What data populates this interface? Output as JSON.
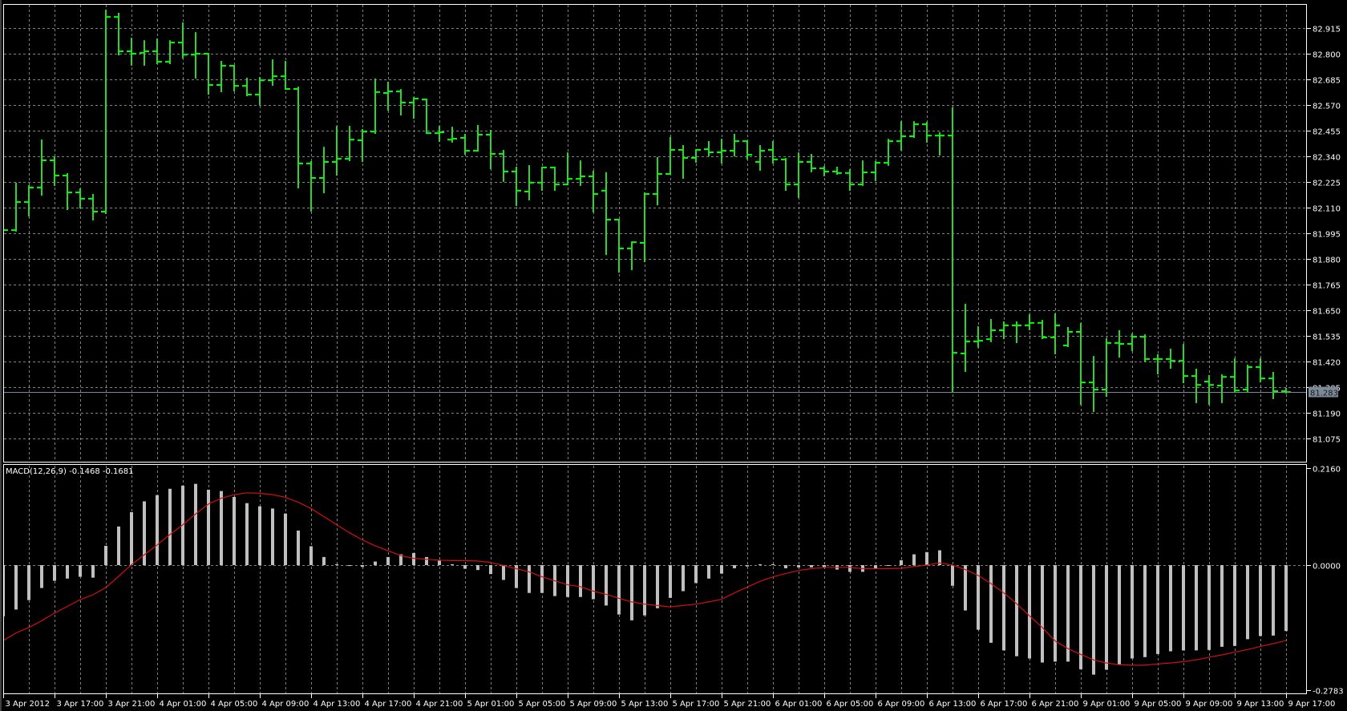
{
  "colors": {
    "background": "#000000",
    "bar_vertical": "#2bd62b",
    "bar_ticks": "#00ff00",
    "grid": "#7f7f7f",
    "border": "#ffffff",
    "histogram": "#c0c0c0",
    "signal": "#d01010",
    "price_line": "#778899",
    "price_label_bg": "#7b8a99",
    "price_label_text": "#1a1a1a"
  },
  "indicator": {
    "title": "MACD(12,26,9) -0.1468 -0.1681"
  },
  "current_price": {
    "label": "81.283",
    "value": 81.283
  },
  "chart_data": [
    {
      "type": "ohlc",
      "title": "",
      "ylim": [
        80.967,
        83.023
      ],
      "grid": true,
      "y_ticks": [
        "82.915",
        "82.800",
        "82.685",
        "82.570",
        "82.455",
        "82.340",
        "82.225",
        "82.110",
        "81.995",
        "81.880",
        "81.765",
        "81.650",
        "81.535",
        "81.420",
        "81.305",
        "81.190",
        "81.075"
      ],
      "x_tick_labels": [
        "3 Apr 2012",
        "3 Apr 17:00",
        "3 Apr 21:00",
        "4 Apr 01:00",
        "4 Apr 05:00",
        "4 Apr 09:00",
        "4 Apr 13:00",
        "4 Apr 17:00",
        "4 Apr 21:00",
        "5 Apr 01:00",
        "5 Apr 05:00",
        "5 Apr 09:00",
        "5 Apr 13:00",
        "5 Apr 17:00",
        "5 Apr 21:00",
        "6 Apr 01:00",
        "6 Apr 05:00",
        "6 Apr 09:00",
        "6 Apr 13:00",
        "6 Apr 17:00",
        "6 Apr 21:00",
        "9 Apr 01:00",
        "9 Apr 05:00",
        "9 Apr 09:00",
        "9 Apr 13:00",
        "9 Apr 17:00"
      ],
      "bars_per_x_label": 4,
      "ohlc": [
        [
          82.0,
          82.012,
          81.995,
          82.009
        ],
        [
          82.009,
          82.218,
          82.006,
          82.135
        ],
        [
          82.135,
          82.207,
          82.074,
          82.2
        ],
        [
          82.2,
          82.412,
          82.167,
          82.322
        ],
        [
          82.322,
          82.336,
          82.211,
          82.254
        ],
        [
          82.254,
          82.261,
          82.103,
          82.178
        ],
        [
          82.178,
          82.193,
          82.11,
          82.15
        ],
        [
          82.15,
          82.168,
          82.056,
          82.092
        ],
        [
          82.092,
          82.994,
          82.085,
          82.965
        ],
        [
          82.965,
          82.98,
          82.796,
          82.811
        ],
        [
          82.811,
          82.868,
          82.75,
          82.8
        ],
        [
          82.804,
          82.857,
          82.75,
          82.811
        ],
        [
          82.811,
          82.865,
          82.757,
          82.764
        ],
        [
          82.764,
          82.857,
          82.757,
          82.85
        ],
        [
          82.85,
          82.937,
          82.782,
          82.796
        ],
        [
          82.796,
          82.893,
          82.692,
          82.8
        ],
        [
          82.8,
          82.8,
          82.62,
          82.66
        ],
        [
          82.66,
          82.764,
          82.631,
          82.746
        ],
        [
          82.746,
          82.746,
          82.635,
          82.656
        ],
        [
          82.656,
          82.689,
          82.613,
          82.617
        ],
        [
          82.617,
          82.692,
          82.574,
          82.681
        ],
        [
          82.681,
          82.771,
          82.66,
          82.699
        ],
        [
          82.699,
          82.764,
          82.642,
          82.642
        ],
        [
          82.642,
          82.649,
          82.2,
          82.308
        ],
        [
          82.308,
          82.315,
          82.096,
          82.243
        ],
        [
          82.243,
          82.379,
          82.178,
          82.315
        ],
        [
          82.315,
          82.473,
          82.257,
          82.329
        ],
        [
          82.329,
          82.473,
          82.322,
          82.415
        ],
        [
          82.412,
          82.459,
          82.318,
          82.451
        ],
        [
          82.451,
          82.685,
          82.444,
          82.628
        ],
        [
          82.624,
          82.671,
          82.548,
          82.631
        ],
        [
          82.631,
          82.638,
          82.527,
          82.581
        ],
        [
          82.581,
          82.602,
          82.512,
          82.599
        ],
        [
          82.595,
          82.595,
          82.444,
          82.444
        ],
        [
          82.444,
          82.473,
          82.408,
          82.448
        ],
        [
          82.415,
          82.469,
          82.405,
          82.419
        ],
        [
          82.423,
          82.437,
          82.351,
          82.365
        ],
        [
          82.365,
          82.477,
          82.365,
          82.437
        ],
        [
          82.437,
          82.455,
          82.286,
          82.351
        ],
        [
          82.351,
          82.365,
          82.229,
          82.272
        ],
        [
          82.272,
          82.29,
          82.121,
          82.186
        ],
        [
          82.182,
          82.297,
          82.146,
          82.222
        ],
        [
          82.222,
          82.29,
          82.189,
          82.29
        ],
        [
          82.29,
          82.29,
          82.189,
          82.214
        ],
        [
          82.214,
          82.354,
          82.214,
          82.239
        ],
        [
          82.239,
          82.318,
          82.211,
          82.25
        ],
        [
          82.25,
          82.272,
          82.092,
          82.171
        ],
        [
          82.186,
          82.265,
          81.901,
          82.056
        ],
        [
          82.056,
          82.056,
          81.822,
          81.927
        ],
        [
          81.927,
          81.955,
          81.833,
          81.955
        ],
        [
          81.952,
          82.175,
          81.869,
          82.171
        ],
        [
          82.171,
          82.333,
          82.124,
          82.261
        ],
        [
          82.261,
          82.423,
          82.261,
          82.369
        ],
        [
          82.369,
          82.387,
          82.243,
          82.333
        ],
        [
          82.333,
          82.369,
          82.315,
          82.369
        ],
        [
          82.372,
          82.405,
          82.343,
          82.358
        ],
        [
          82.358,
          82.415,
          82.311,
          82.365
        ],
        [
          82.365,
          82.437,
          82.343,
          82.408
        ],
        [
          82.408,
          82.408,
          82.329,
          82.347
        ],
        [
          82.315,
          82.387,
          82.279,
          82.365
        ],
        [
          82.369,
          82.405,
          82.311,
          82.326
        ],
        [
          82.326,
          82.329,
          82.189,
          82.214
        ],
        [
          82.214,
          82.354,
          82.157,
          82.315
        ],
        [
          82.315,
          82.347,
          82.272,
          82.286
        ],
        [
          82.286,
          82.293,
          82.254,
          82.272
        ],
        [
          82.272,
          82.29,
          82.261,
          82.265
        ],
        [
          82.265,
          82.279,
          82.189,
          82.214
        ],
        [
          82.214,
          82.318,
          82.211,
          82.268
        ],
        [
          82.268,
          82.315,
          82.232,
          82.311
        ],
        [
          82.311,
          82.415,
          82.301,
          82.408
        ],
        [
          82.408,
          82.494,
          82.369,
          82.43
        ],
        [
          82.43,
          82.494,
          82.426,
          82.484
        ],
        [
          82.484,
          82.491,
          82.405,
          82.433
        ],
        [
          82.433,
          82.444,
          82.347,
          82.433
        ],
        [
          82.433,
          82.556,
          81.287,
          81.459
        ],
        [
          81.456,
          81.675,
          81.377,
          81.51
        ],
        [
          81.51,
          81.574,
          81.485,
          81.513
        ],
        [
          81.52,
          81.607,
          81.51,
          81.56
        ],
        [
          81.56,
          81.596,
          81.524,
          81.582
        ],
        [
          81.582,
          81.596,
          81.506,
          81.582
        ],
        [
          81.582,
          81.628,
          81.564,
          81.593
        ],
        [
          81.593,
          81.603,
          81.524,
          81.528
        ],
        [
          81.528,
          81.632,
          81.456,
          81.582
        ],
        [
          81.492,
          81.571,
          81.488,
          81.553
        ],
        [
          81.553,
          81.589,
          81.229,
          81.326
        ],
        [
          81.326,
          81.441,
          81.197,
          81.294
        ],
        [
          81.294,
          81.52,
          81.265,
          81.503
        ],
        [
          81.503,
          81.557,
          81.441,
          81.499
        ],
        [
          81.499,
          81.542,
          81.47,
          81.531
        ],
        [
          81.531,
          81.538,
          81.423,
          81.431
        ],
        [
          81.431,
          81.449,
          81.366,
          81.431
        ],
        [
          81.431,
          81.474,
          81.391,
          81.423
        ],
        [
          81.423,
          81.495,
          81.326,
          81.355
        ],
        [
          81.355,
          81.384,
          81.237,
          81.315
        ],
        [
          81.33,
          81.355,
          81.229,
          81.315
        ],
        [
          81.312,
          81.359,
          81.237,
          81.351
        ],
        [
          81.351,
          81.431,
          81.283,
          81.29
        ],
        [
          81.294,
          81.402,
          81.287,
          81.395
        ],
        [
          81.395,
          81.431,
          81.33,
          81.344
        ],
        [
          81.344,
          81.37,
          81.255,
          81.287
        ],
        [
          81.287,
          81.298,
          81.28,
          81.283
        ]
      ]
    },
    {
      "type": "bar",
      "title": "MACD(12,26,9)",
      "ylim": [
        -0.2875,
        0.2232
      ],
      "y_ticks": [
        "0.2160",
        "0.0000",
        "-0.2783"
      ],
      "y_tick_values": [
        0.216,
        0.0,
        -0.2783
      ],
      "series": [
        {
          "name": "MACD",
          "kind": "histogram",
          "values": [
            -0.114,
            -0.099,
            -0.078,
            -0.051,
            -0.035,
            -0.03,
            -0.026,
            -0.028,
            0.043,
            0.086,
            0.118,
            0.142,
            0.156,
            0.17,
            0.177,
            0.181,
            0.168,
            0.165,
            0.152,
            0.138,
            0.131,
            0.126,
            0.115,
            0.077,
            0.042,
            0.018,
            0.002,
            -0.002,
            -0.004,
            0.008,
            0.018,
            0.024,
            0.027,
            0.018,
            0.01,
            0.002,
            -0.008,
            -0.011,
            -0.02,
            -0.033,
            -0.051,
            -0.062,
            -0.062,
            -0.069,
            -0.071,
            -0.071,
            -0.076,
            -0.09,
            -0.11,
            -0.123,
            -0.112,
            -0.096,
            -0.073,
            -0.058,
            -0.04,
            -0.03,
            -0.019,
            -0.007,
            -0.003,
            0.002,
            0.002,
            -0.007,
            -0.005,
            -0.005,
            -0.005,
            -0.01,
            -0.015,
            -0.015,
            -0.008,
            0.0,
            0.011,
            0.024,
            0.029,
            0.033,
            -0.046,
            -0.101,
            -0.144,
            -0.173,
            -0.19,
            -0.203,
            -0.208,
            -0.217,
            -0.215,
            -0.215,
            -0.232,
            -0.244,
            -0.233,
            -0.221,
            -0.208,
            -0.205,
            -0.198,
            -0.192,
            -0.19,
            -0.19,
            -0.189,
            -0.182,
            -0.18,
            -0.165,
            -0.158,
            -0.157,
            -0.1468
          ]
        },
        {
          "name": "Signal",
          "kind": "line",
          "values": [
            -0.168,
            -0.151,
            -0.139,
            -0.124,
            -0.107,
            -0.092,
            -0.077,
            -0.066,
            -0.05,
            -0.025,
            0.001,
            0.023,
            0.045,
            0.068,
            0.09,
            0.114,
            0.136,
            0.149,
            0.157,
            0.161,
            0.16,
            0.157,
            0.151,
            0.14,
            0.126,
            0.108,
            0.09,
            0.072,
            0.056,
            0.043,
            0.032,
            0.021,
            0.015,
            0.013,
            0.011,
            0.01,
            0.01,
            0.009,
            0.006,
            -0.001,
            -0.008,
            -0.015,
            -0.026,
            -0.035,
            -0.044,
            -0.048,
            -0.058,
            -0.065,
            -0.074,
            -0.082,
            -0.087,
            -0.09,
            -0.093,
            -0.09,
            -0.087,
            -0.082,
            -0.076,
            -0.062,
            -0.049,
            -0.036,
            -0.026,
            -0.019,
            -0.012,
            -0.008,
            -0.005,
            -0.005,
            -0.005,
            -0.008,
            -0.008,
            -0.008,
            -0.007,
            -0.003,
            0.0,
            0.005,
            0.0,
            -0.01,
            -0.023,
            -0.041,
            -0.062,
            -0.086,
            -0.113,
            -0.139,
            -0.169,
            -0.186,
            -0.199,
            -0.211,
            -0.218,
            -0.222,
            -0.223,
            -0.223,
            -0.22,
            -0.218,
            -0.215,
            -0.211,
            -0.205,
            -0.2,
            -0.194,
            -0.188,
            -0.181,
            -0.175,
            -0.1681
          ]
        }
      ]
    }
  ]
}
